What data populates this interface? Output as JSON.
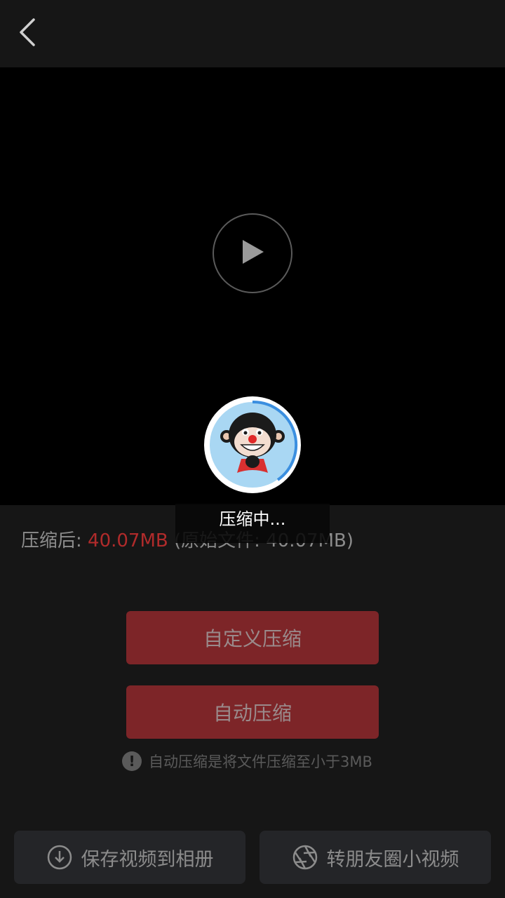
{
  "header": {
    "back_icon": "chevron-left-icon"
  },
  "video": {
    "play_icon": "play-icon"
  },
  "compress": {
    "result_label": "压缩后: ",
    "result_size": "40.07MB",
    "original_text": " (原始文件: 40.07MB)",
    "overlay_text": "压缩中..."
  },
  "buttons": {
    "custom_compress": "自定义压缩",
    "auto_compress": "自动压缩"
  },
  "hint": {
    "icon": "exclamation-icon",
    "text": "自动压缩是将文件压缩至小于3MB"
  },
  "bottom": {
    "save_album": "保存视频到相册",
    "share_moments": "转朋友圈小视频"
  },
  "colors": {
    "accent_red": "#7d2528",
    "highlight_red": "#b02b2b",
    "progress_blue": "#3b8fe0"
  }
}
